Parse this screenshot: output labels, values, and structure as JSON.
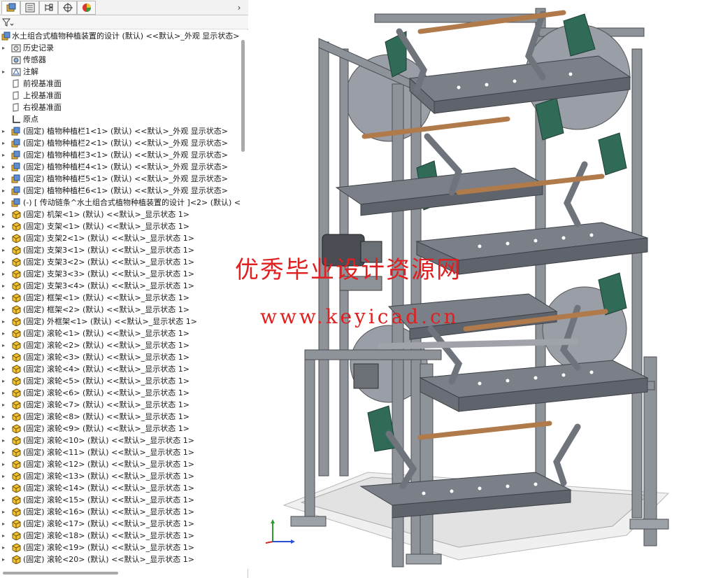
{
  "panel": {
    "tabs": [
      {
        "name": "feature-manager-tab",
        "icon": "part-tree-icon"
      },
      {
        "name": "property-manager-tab",
        "icon": "property-list-icon"
      },
      {
        "name": "configuration-manager-tab",
        "icon": "configuration-icon"
      },
      {
        "name": "dimxpert-tab",
        "icon": "crosshair-icon"
      },
      {
        "name": "display-manager-tab",
        "icon": "color-ball-icon"
      }
    ],
    "expand_glyph": "›",
    "root_label": "水土组合式植物种植装置的设计 (默认) <<默认>_外观 显示状态>",
    "items": [
      {
        "label": "历史记录",
        "icon": "history-icon",
        "arrow": "▸"
      },
      {
        "label": "传感器",
        "icon": "sensor-icon",
        "arrow": ""
      },
      {
        "label": "注解",
        "icon": "annotation-icon",
        "arrow": "▸"
      },
      {
        "label": "前视基准面",
        "icon": "plane-icon",
        "arrow": ""
      },
      {
        "label": "上视基准面",
        "icon": "plane-icon",
        "arrow": ""
      },
      {
        "label": "右视基准面",
        "icon": "plane-icon",
        "arrow": ""
      },
      {
        "label": "原点",
        "icon": "origin-icon",
        "arrow": ""
      },
      {
        "label": "(固定) 植物种植栏1<1> (默认) <<默认>_外观 显示状态>",
        "icon": "subassembly-icon",
        "arrow": "▸"
      },
      {
        "label": "(固定) 植物种植栏2<1> (默认) <<默认>_外观 显示状态>",
        "icon": "subassembly-icon",
        "arrow": "▸"
      },
      {
        "label": "(固定) 植物种植栏3<1> (默认) <<默认>_外观 显示状态>",
        "icon": "subassembly-icon",
        "arrow": "▸"
      },
      {
        "label": "(固定) 植物种植栏4<1> (默认) <<默认>_外观 显示状态>",
        "icon": "subassembly-icon",
        "arrow": "▸"
      },
      {
        "label": "(固定) 植物种植栏5<1> (默认) <<默认>_外观 显示状态>",
        "icon": "subassembly-icon",
        "arrow": "▸"
      },
      {
        "label": "(固定) 植物种植栏6<1> (默认) <<默认>_外观 显示状态>",
        "icon": "subassembly-icon",
        "arrow": "▸"
      },
      {
        "label": "(-) [ 传动链条^水土组合式植物种植装置的设计 ]<2> (默认) <默认",
        "icon": "subassembly-icon",
        "arrow": "▸"
      },
      {
        "label": "(固定) 机架<1> (默认) <<默认>_显示状态 1>",
        "icon": "part-icon",
        "arrow": "▸"
      },
      {
        "label": "(固定) 支架<1> (默认) <<默认>_显示状态 1>",
        "icon": "part-icon",
        "arrow": "▸"
      },
      {
        "label": "(固定) 支架2<1> (默认) <<默认>_显示状态 1>",
        "icon": "part-icon",
        "arrow": "▸"
      },
      {
        "label": "(固定) 支架3<1> (默认) <<默认>_显示状态 1>",
        "icon": "part-icon",
        "arrow": "▸"
      },
      {
        "label": "(固定) 支架3<2> (默认) <<默认>_显示状态 1>",
        "icon": "part-icon",
        "arrow": "▸"
      },
      {
        "label": "(固定) 支架3<3> (默认) <<默认>_显示状态 1>",
        "icon": "part-icon",
        "arrow": "▸"
      },
      {
        "label": "(固定) 支架3<4> (默认) <<默认>_显示状态 1>",
        "icon": "part-icon",
        "arrow": "▸"
      },
      {
        "label": "(固定) 框架<1> (默认) <<默认>_显示状态 1>",
        "icon": "part-icon",
        "arrow": "▸"
      },
      {
        "label": "(固定) 框架<2> (默认) <<默认>_显示状态 1>",
        "icon": "part-icon",
        "arrow": "▸"
      },
      {
        "label": "(固定) 外框架<1> (默认) <<默认>_显示状态 1>",
        "icon": "part-icon",
        "arrow": "▸"
      },
      {
        "label": "(固定) 滚轮<1> (默认) <<默认>_显示状态 1>",
        "icon": "part-icon",
        "arrow": "▸"
      },
      {
        "label": "(固定) 滚轮<2> (默认) <<默认>_显示状态 1>",
        "icon": "part-icon",
        "arrow": "▸"
      },
      {
        "label": "(固定) 滚轮<3> (默认) <<默认>_显示状态 1>",
        "icon": "part-icon",
        "arrow": "▸"
      },
      {
        "label": "(固定) 滚轮<4> (默认) <<默认>_显示状态 1>",
        "icon": "part-icon",
        "arrow": "▸"
      },
      {
        "label": "(固定) 滚轮<5> (默认) <<默认>_显示状态 1>",
        "icon": "part-icon",
        "arrow": "▸"
      },
      {
        "label": "(固定) 滚轮<6> (默认) <<默认>_显示状态 1>",
        "icon": "part-icon",
        "arrow": "▸"
      },
      {
        "label": "(固定) 滚轮<7> (默认) <<默认>_显示状态 1>",
        "icon": "part-icon",
        "arrow": "▸"
      },
      {
        "label": "(固定) 滚轮<8> (默认) <<默认>_显示状态 1>",
        "icon": "part-icon",
        "arrow": "▸"
      },
      {
        "label": "(固定) 滚轮<9> (默认) <<默认>_显示状态 1>",
        "icon": "part-icon",
        "arrow": "▸"
      },
      {
        "label": "(固定) 滚轮<10> (默认) <<默认>_显示状态 1>",
        "icon": "part-icon",
        "arrow": "▸"
      },
      {
        "label": "(固定) 滚轮<11> (默认) <<默认>_显示状态 1>",
        "icon": "part-icon",
        "arrow": "▸"
      },
      {
        "label": "(固定) 滚轮<12> (默认) <<默认>_显示状态 1>",
        "icon": "part-icon",
        "arrow": "▸"
      },
      {
        "label": "(固定) 滚轮<13> (默认) <<默认>_显示状态 1>",
        "icon": "part-icon",
        "arrow": "▸"
      },
      {
        "label": "(固定) 滚轮<14> (默认) <<默认>_显示状态 1>",
        "icon": "part-icon",
        "arrow": "▸"
      },
      {
        "label": "(固定) 滚轮<15> (默认) <<默认>_显示状态 1>",
        "icon": "part-icon",
        "arrow": "▸"
      },
      {
        "label": "(固定) 滚轮<16> (默认) <<默认>_显示状态 1>",
        "icon": "part-icon",
        "arrow": "▸"
      },
      {
        "label": "(固定) 滚轮<17> (默认) <<默认>_显示状态 1>",
        "icon": "part-icon",
        "arrow": "▸"
      },
      {
        "label": "(固定) 滚轮<18> (默认) <<默认>_显示状态 1>",
        "icon": "part-icon",
        "arrow": "▸"
      },
      {
        "label": "(固定) 滚轮<19> (默认) <<默认>_显示状态 1>",
        "icon": "part-icon",
        "arrow": "▸"
      },
      {
        "label": "(固定) 滚轮<20> (默认) <<默认>_显示状态 1>",
        "icon": "part-icon",
        "arrow": "▸"
      }
    ]
  },
  "viewport": {
    "watermark_text": "优秀毕业设计资源网",
    "watermark_url": "www.keyicad.cn",
    "triad_icon": "coordinate-triad-icon",
    "colors": {
      "frame": "#8e9299",
      "tray": "#7a7f88",
      "rod": "#b07a4a",
      "bracket": "#2f6b57",
      "watermark": "#e02020"
    }
  }
}
